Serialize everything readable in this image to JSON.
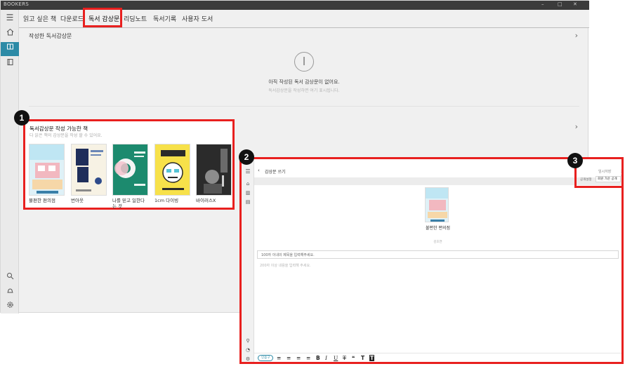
{
  "app": {
    "title": "BOOKERS"
  },
  "window_controls": [
    "–",
    "□",
    "✕"
  ],
  "sidebar": {
    "top_icons": [
      "menu-icon",
      "home-icon",
      "library-icon",
      "book-icon"
    ],
    "bottom_icons": [
      "search-icon",
      "bell-icon",
      "settings-icon"
    ]
  },
  "tabs": [
    "읽고 싶은 책",
    "다운로드",
    "독서 감상문",
    "리딩노트",
    "독서기록",
    "사용자 도서"
  ],
  "selected_tab": "독서 감상문",
  "written_section": {
    "title": "작성한 독서감상문",
    "empty_title": "아직 작성된 독서 감상문이 없어요.",
    "empty_subtitle": "독서감상문을 작성하면 여기 표시됩니다."
  },
  "panel1": {
    "badge": "1",
    "title": "독서감상문 작성 가능한 책",
    "subtitle": "다 읽은 책의 감상문을 작성 할 수 있어요.",
    "books": [
      {
        "title": "불편한 편의점"
      },
      {
        "title": "번아웃"
      },
      {
        "title": "나를 믿고 일한다는 것"
      },
      {
        "title": "1cm 다이빙"
      },
      {
        "title": "바이러스X"
      }
    ]
  },
  "panel2": {
    "badge": "2",
    "header_title": "감상문 쓰기",
    "temp_save": "임시저장",
    "save": "저장",
    "book_title": "불편한 편의점",
    "author": "김호연",
    "title_placeholder": "100자 이내의 제목을 입력해주세요.",
    "body_placeholder": "200자 이상 내용을 입력해 주세요.",
    "toolbar_pill": "인용구",
    "toolbar_tools": [
      "≡",
      "≡",
      "≡",
      "≡",
      "B",
      "I",
      "U",
      "T",
      "❝",
      "T",
      "T"
    ]
  },
  "panel3": {
    "badge": "3",
    "visibility_label": "공개설정",
    "visibility_value": "회원 가운 공개"
  },
  "colors": {
    "accent": "#2c8aa6",
    "callout": "#e8201f"
  }
}
